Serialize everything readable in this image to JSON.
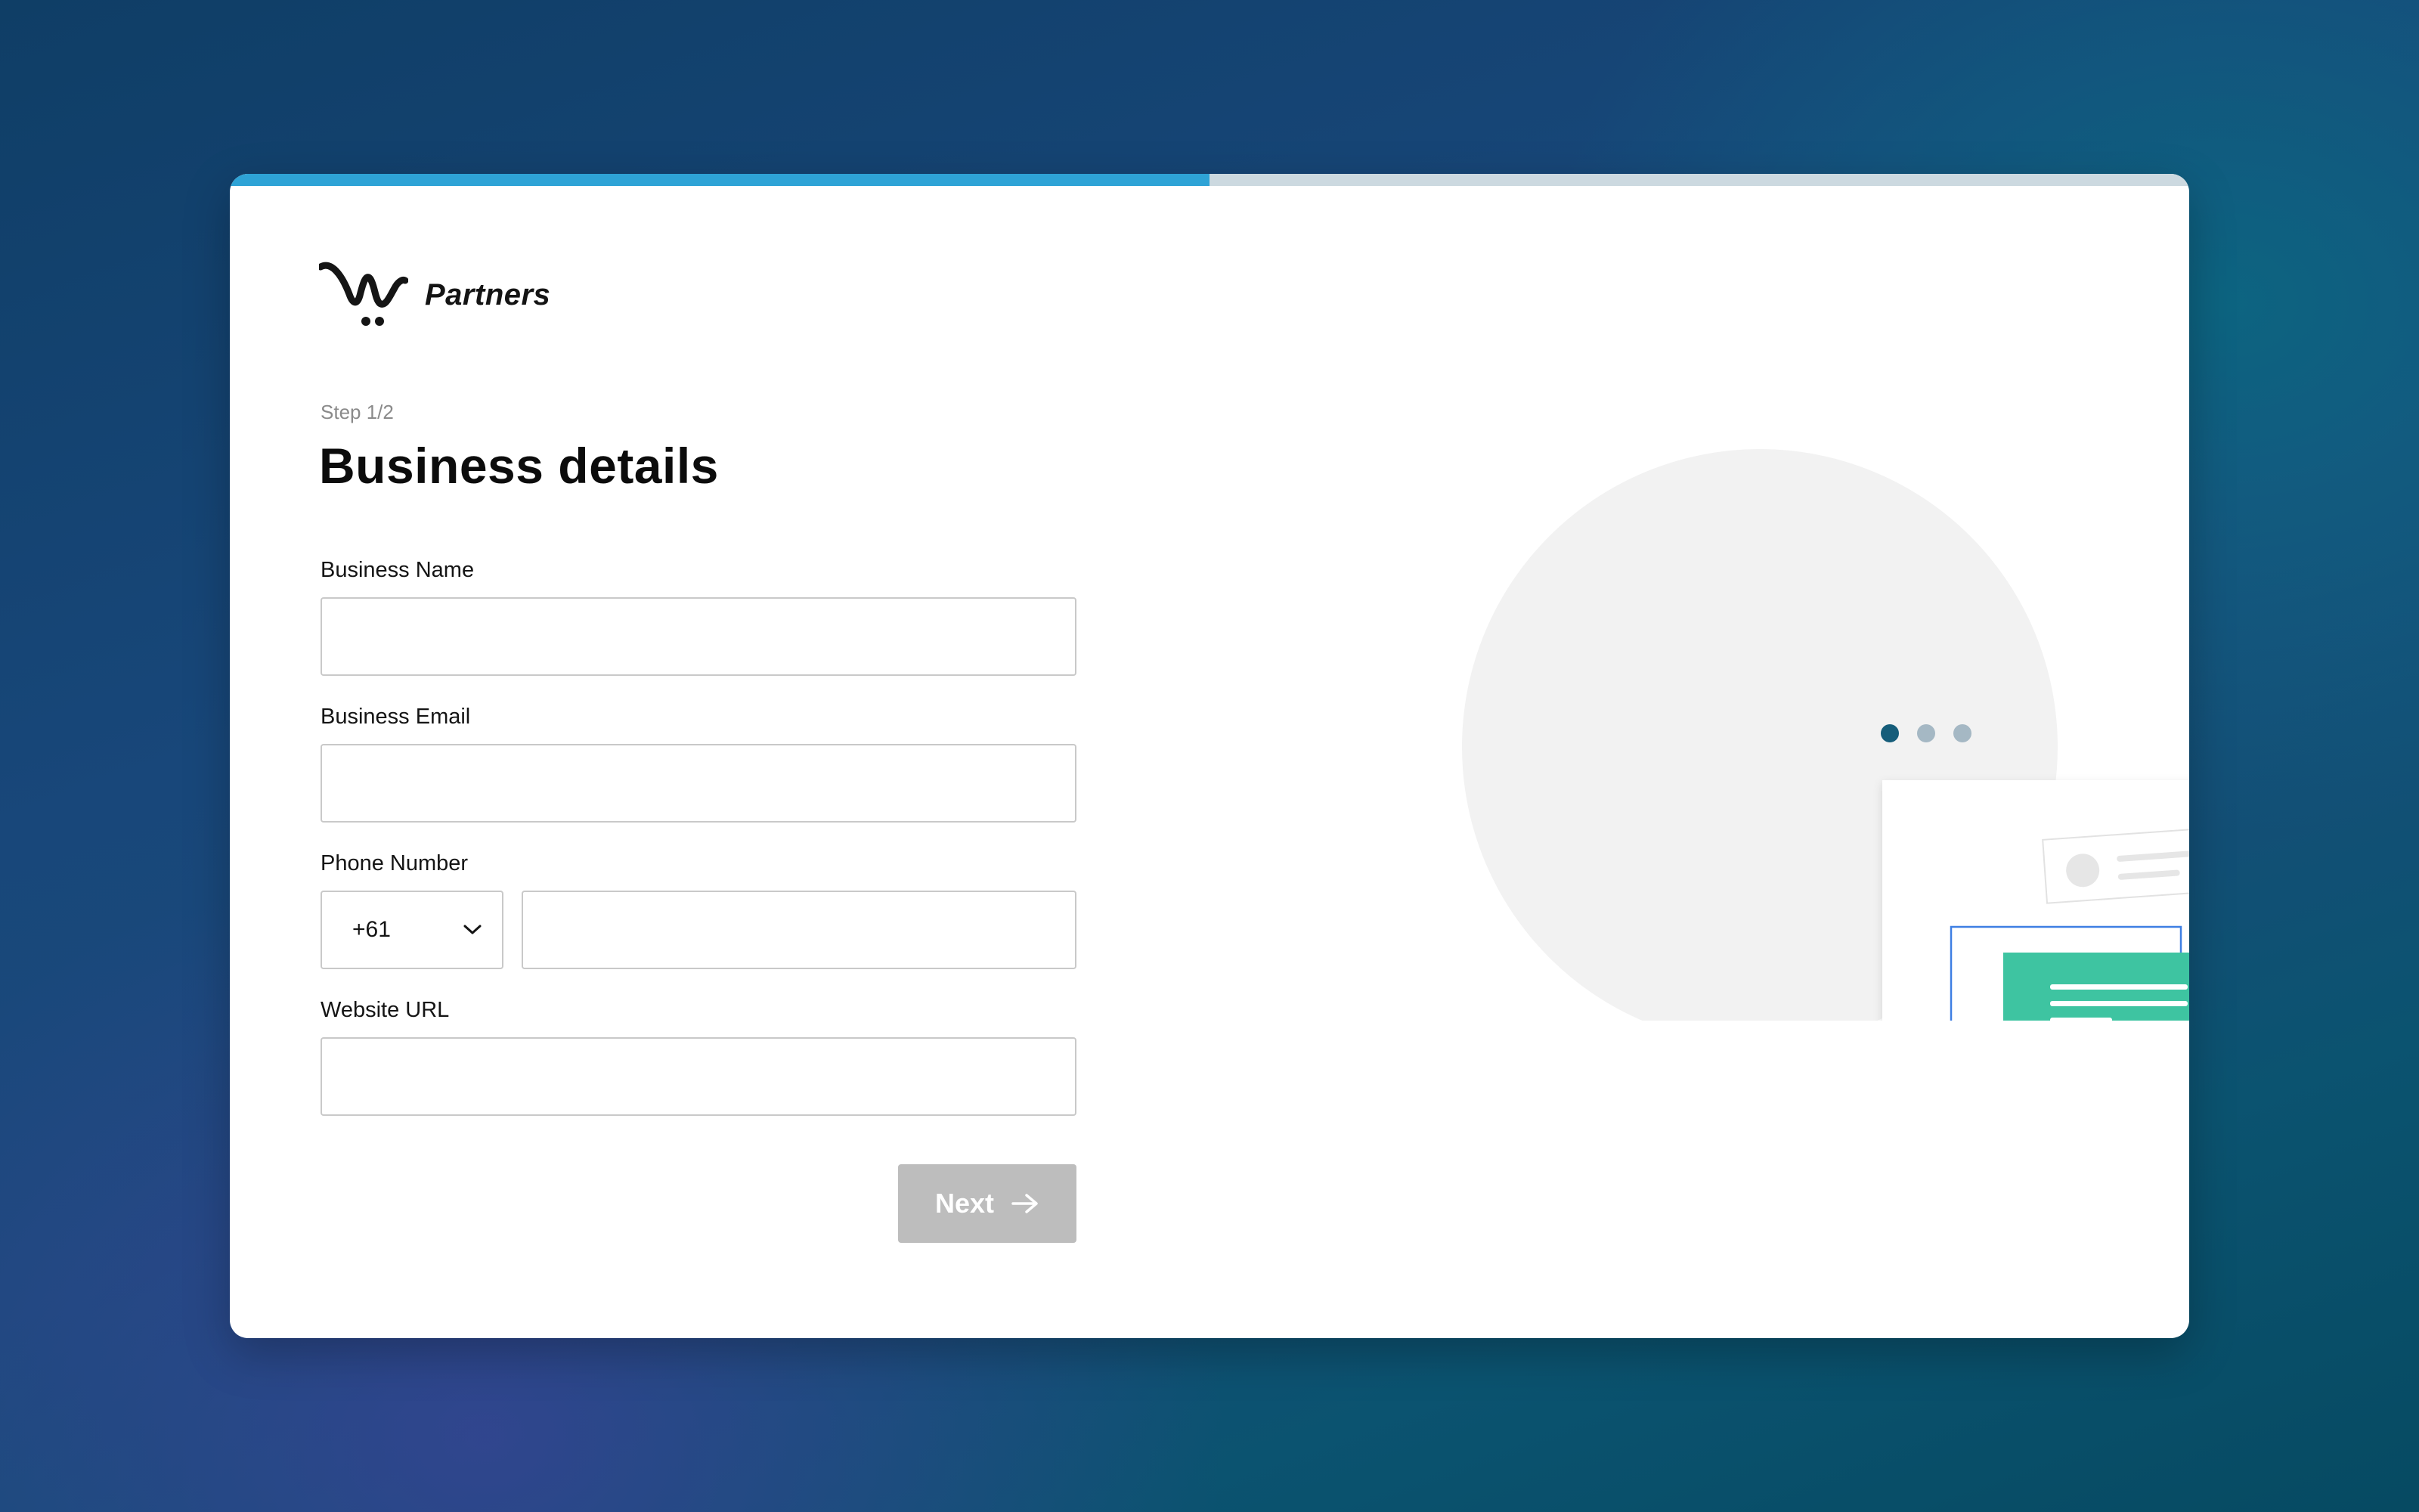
{
  "progress": {
    "fraction": 0.5
  },
  "brand": {
    "name": "Partners",
    "logo_icon": "w-cart-logo-icon"
  },
  "step": {
    "label": "Step 1/2"
  },
  "page": {
    "title": "Business details"
  },
  "form": {
    "business_name": {
      "label": "Business Name",
      "value": "",
      "placeholder": ""
    },
    "business_email": {
      "label": "Business Email",
      "value": "",
      "placeholder": ""
    },
    "phone": {
      "label": "Phone Number",
      "country_code": "+61",
      "value": "",
      "placeholder": ""
    },
    "website": {
      "label": "Website URL",
      "value": "",
      "placeholder": ""
    }
  },
  "actions": {
    "next_label": "Next",
    "next_icon": "arrow-right-icon"
  },
  "illustration": {
    "carousel_dots": 3,
    "active_dot": 1
  },
  "colors": {
    "progress_fill": "#2ea3d6",
    "progress_track": "#ccd9e0",
    "button_disabled": "#bdbdbd",
    "accent_green": "#3ec4a1",
    "accent_blue": "#2f7ff0",
    "accent_yellow": "#fbd532",
    "dot_active": "#165d7a",
    "dot_inactive": "#a5b8c4"
  }
}
